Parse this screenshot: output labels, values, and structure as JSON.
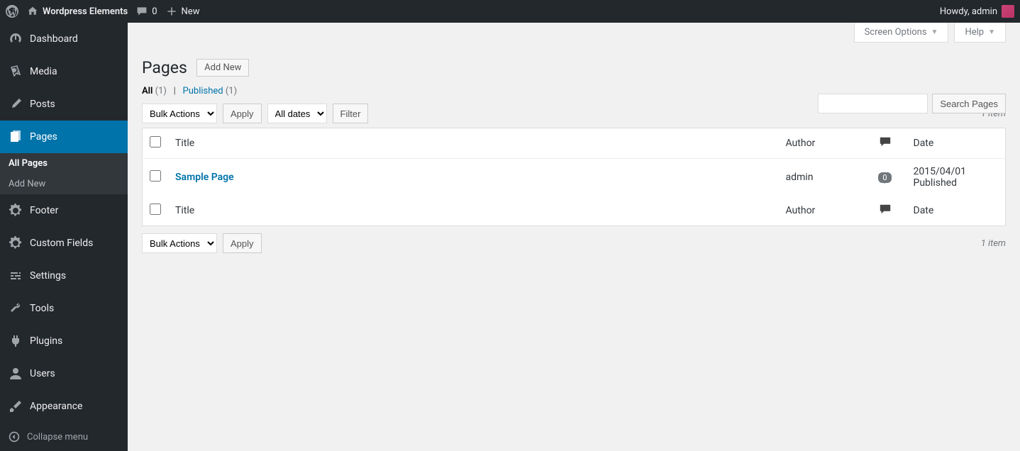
{
  "adminbar": {
    "site_name": "Wordpress Elements",
    "comments_count": "0",
    "new_label": "New",
    "howdy": "Howdy, admin"
  },
  "sidebar": {
    "items": [
      {
        "label": "Dashboard"
      },
      {
        "label": "Media"
      },
      {
        "label": "Posts"
      },
      {
        "label": "Pages"
      },
      {
        "label": "Footer"
      },
      {
        "label": "Custom Fields"
      },
      {
        "label": "Settings"
      },
      {
        "label": "Tools"
      },
      {
        "label": "Plugins"
      },
      {
        "label": "Users"
      },
      {
        "label": "Appearance"
      }
    ],
    "submenu": [
      {
        "label": "All Pages"
      },
      {
        "label": "Add New"
      }
    ],
    "collapse": "Collapse menu"
  },
  "screen_meta": {
    "screen_options": "Screen Options",
    "help": "Help"
  },
  "page": {
    "title": "Pages",
    "add_new": "Add New"
  },
  "filters": {
    "all_label": "All",
    "all_count": "(1)",
    "sep": "|",
    "published_label": "Published",
    "published_count": "(1)"
  },
  "search": {
    "button": "Search Pages"
  },
  "bulk": {
    "label": "Bulk Actions",
    "apply": "Apply",
    "dates": "All dates",
    "filter": "Filter"
  },
  "pagination": {
    "text": "1 item"
  },
  "table": {
    "headers": {
      "title": "Title",
      "author": "Author",
      "date": "Date"
    },
    "rows": [
      {
        "title": "Sample Page",
        "author": "admin",
        "comments": "0",
        "date_line1": "2015/04/01",
        "date_line2": "Published"
      }
    ]
  }
}
